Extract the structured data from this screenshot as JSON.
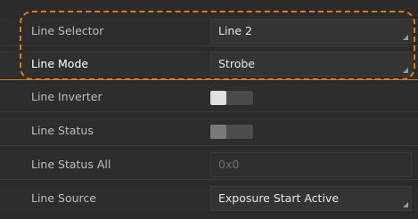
{
  "colors": {
    "background": "#2b2b2b",
    "highlight": "#e07a1e",
    "text": "#bdbdbd",
    "value_text": "#e6e6e6"
  },
  "rows": [
    {
      "label": "Line Selector",
      "value": "Line 2",
      "type": "select"
    },
    {
      "label": "Line Mode",
      "value": "Strobe",
      "type": "select"
    },
    {
      "label": "Line Inverter",
      "type": "toggle",
      "state": "off"
    },
    {
      "label": "Line Status",
      "type": "toggle",
      "state": "off",
      "disabled": true
    },
    {
      "label": "Line Status All",
      "value": "0x0",
      "type": "readonly"
    },
    {
      "label": "Line Source",
      "value": "Exposure Start Active",
      "type": "select"
    }
  ]
}
